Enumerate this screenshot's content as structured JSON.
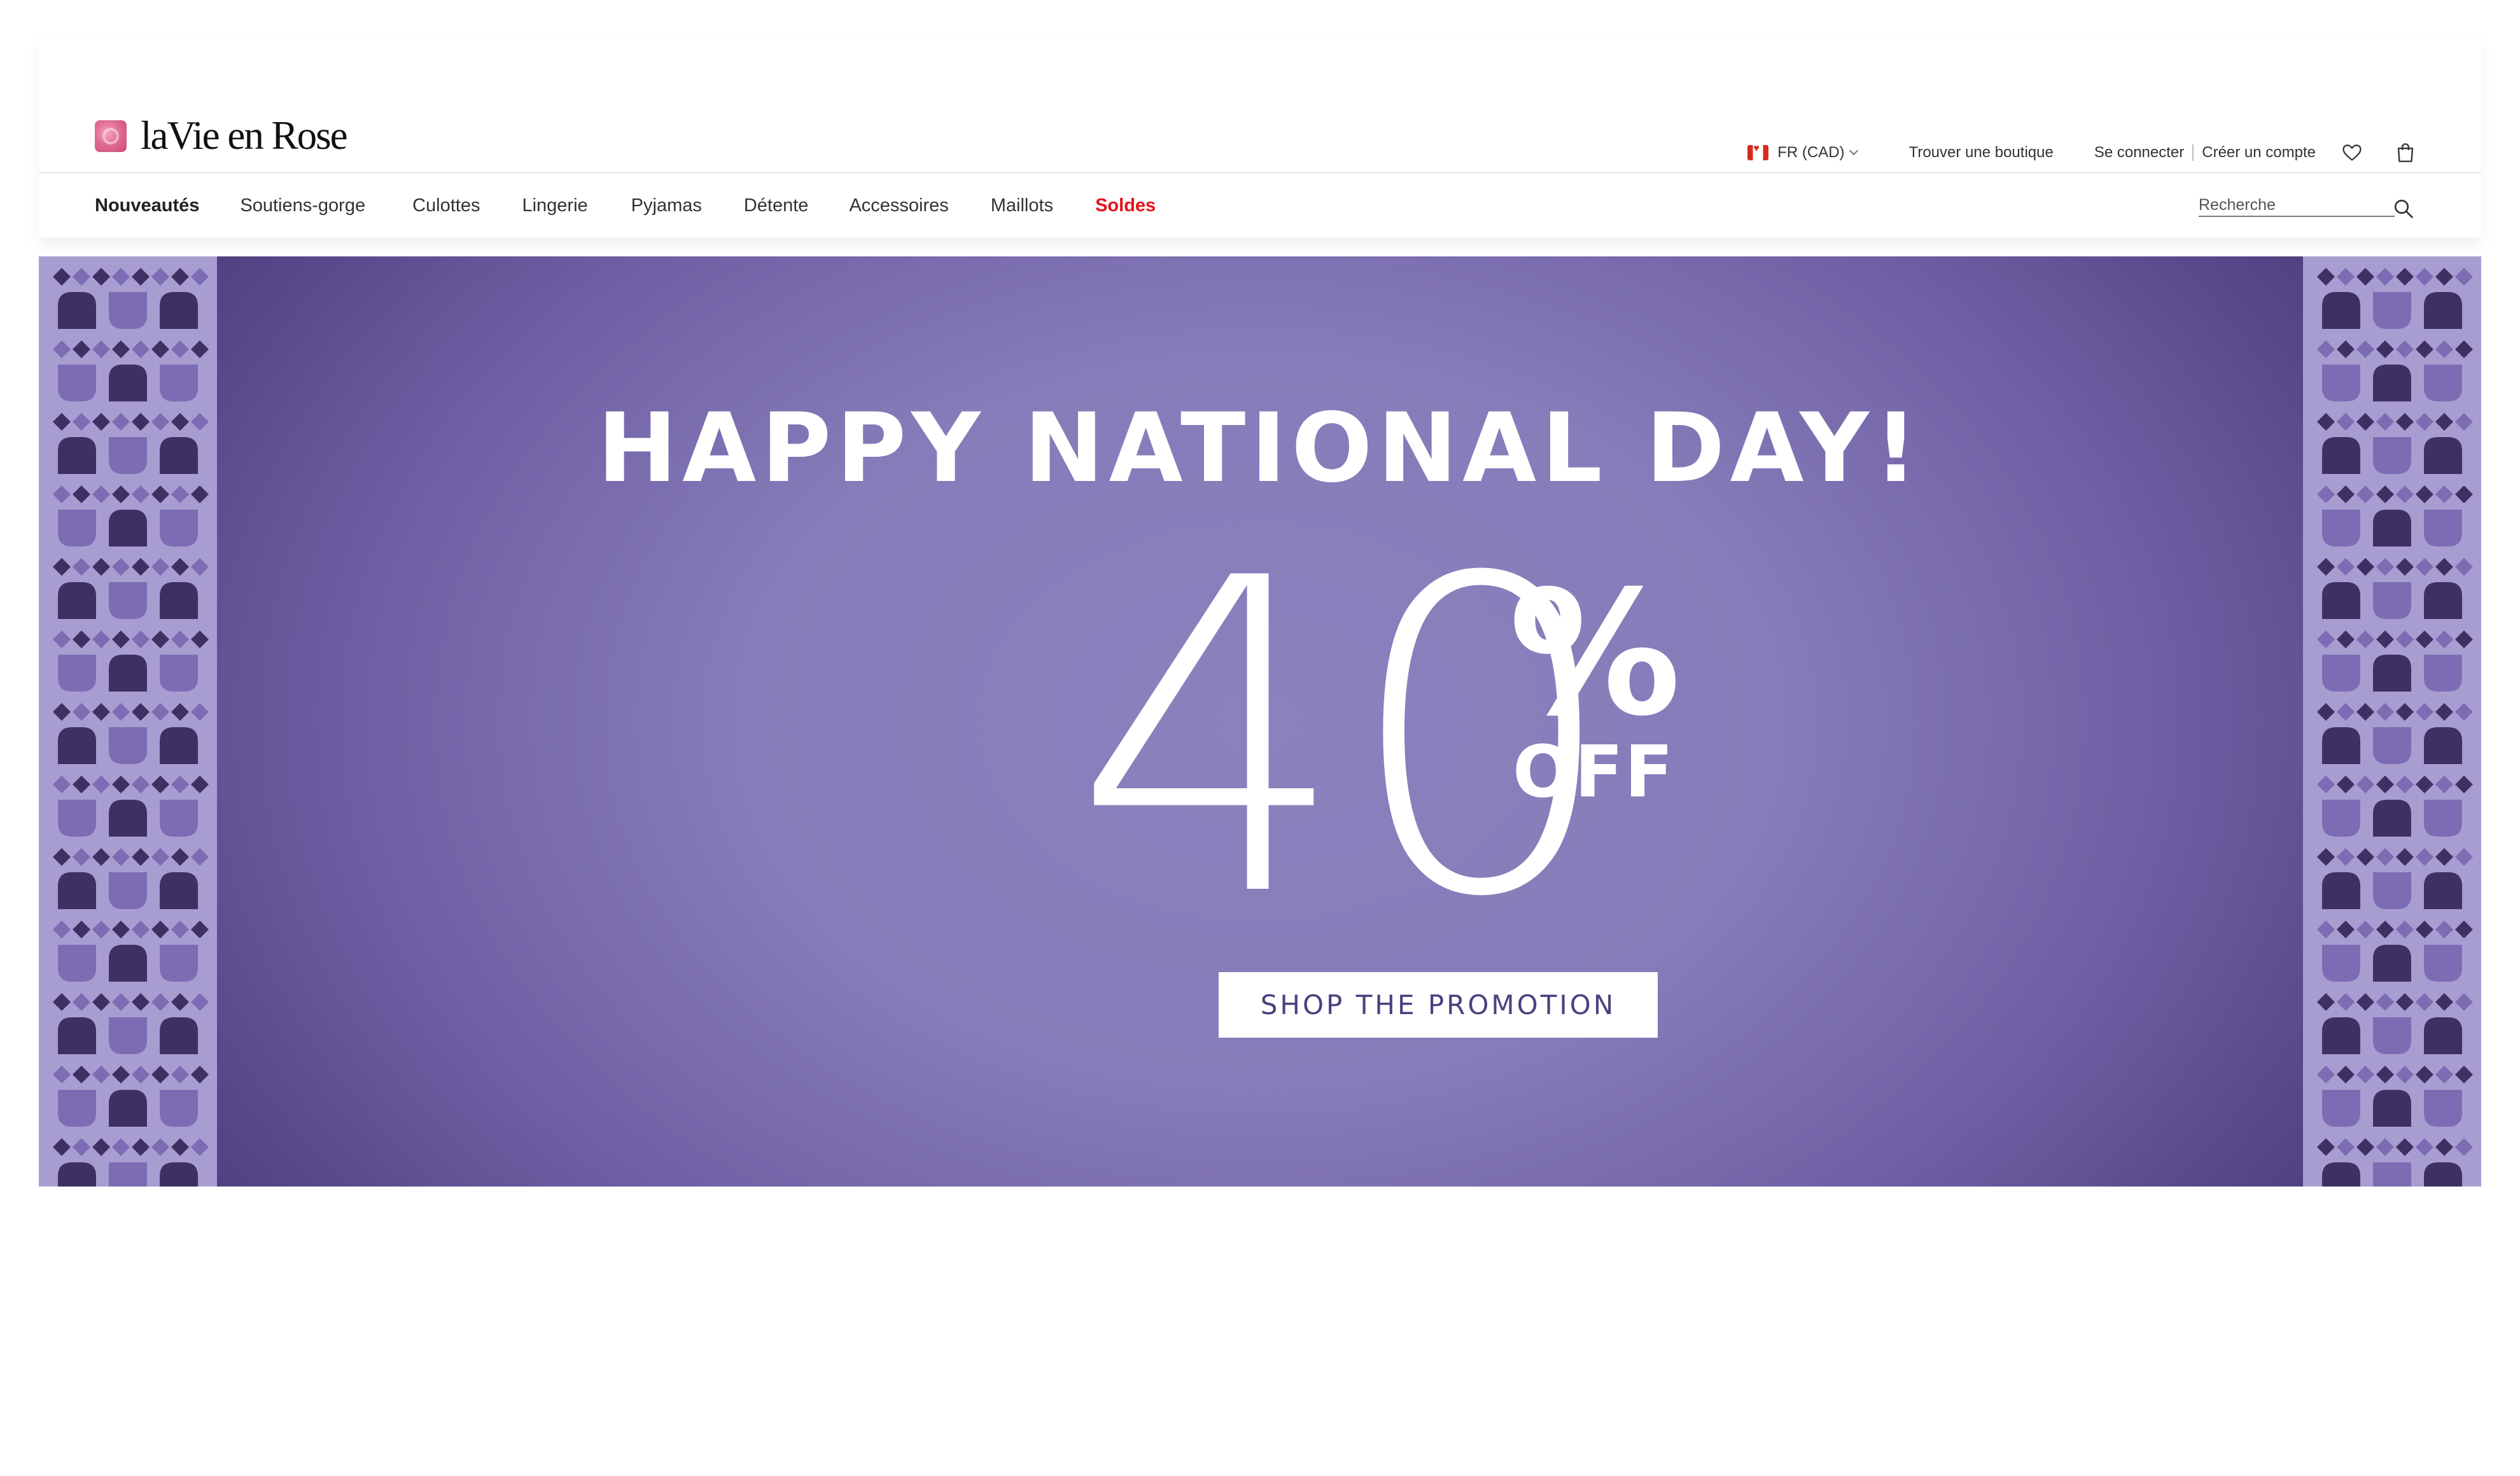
{
  "brand": {
    "name": "laVie en Rose"
  },
  "header": {
    "locale": "FR (CAD)",
    "find_store": "Trouver une boutique",
    "sign_in": "Se connecter",
    "create_account": "Créer un compte"
  },
  "nav": {
    "items": [
      {
        "label": "Nouveautés",
        "bold": true,
        "color": "#222222"
      },
      {
        "label": "Soutiens-gorge",
        "bold": false,
        "color": "#333333"
      },
      {
        "label": "Culottes",
        "bold": false,
        "color": "#333333"
      },
      {
        "label": "Lingerie",
        "bold": false,
        "color": "#333333"
      },
      {
        "label": "Pyjamas",
        "bold": false,
        "color": "#333333"
      },
      {
        "label": "Détente",
        "bold": false,
        "color": "#333333"
      },
      {
        "label": "Accessoires",
        "bold": false,
        "color": "#333333"
      },
      {
        "label": "Maillots",
        "bold": false,
        "color": "#333333"
      },
      {
        "label": "Soldes",
        "bold": true,
        "color": "#e3131b"
      }
    ]
  },
  "search": {
    "placeholder": "Recherche"
  },
  "hero": {
    "headline": "HAPPY NATIONAL DAY!",
    "discount_number": "40",
    "percent_sign": "%",
    "off_label": "OFF",
    "cta_label": "SHOP THE PROMOTION"
  },
  "colors": {
    "accent_sale": "#e3131b",
    "hero_dark": "#4f3f80",
    "hero_mid": "#877bb9",
    "pattern_bg": "#a89dd1",
    "pattern_dark": "#3e3063",
    "pattern_mid": "#7b6cb4",
    "cta_text": "#4d3f7f"
  }
}
